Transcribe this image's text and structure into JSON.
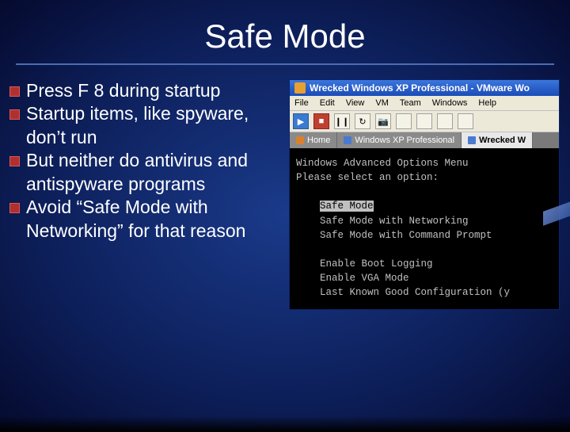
{
  "title": "Safe Mode",
  "bullets": [
    "Press F 8 during startup",
    "Startup items, like spyware, don’t run",
    "But neither do antivirus and antispyware programs",
    "Avoid “Safe Mode with Networking” for that reason"
  ],
  "vm": {
    "title": "Wrecked Windows XP Professional - VMware Wo",
    "menu": [
      "File",
      "Edit",
      "View",
      "VM",
      "Team",
      "Windows",
      "Help"
    ],
    "tabs": [
      {
        "label": "Home",
        "active": false
      },
      {
        "label": "Windows XP Professional",
        "active": false
      },
      {
        "label": "Wrecked W",
        "active": true
      }
    ],
    "console": {
      "header1": "Windows Advanced Options Menu",
      "header2": "Please select an option:",
      "opt1": "Safe Mode",
      "opt2": "Safe Mode with Networking",
      "opt3": "Safe Mode with Command Prompt",
      "opt4": "Enable Boot Logging",
      "opt5": "Enable VGA Mode",
      "opt6": "Last Known Good Configuration (y"
    }
  }
}
